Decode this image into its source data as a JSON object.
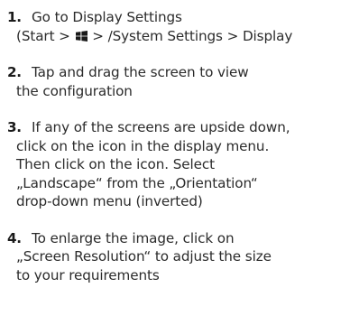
{
  "steps": [
    {
      "number": "1.",
      "lines": [
        "Go to Display Settings"
      ],
      "path": {
        "open": "(Start > ",
        "icon": "windows-logo-icon",
        "rest": " > /System Settings > Display"
      }
    },
    {
      "number": "2.",
      "lines": [
        "Tap and drag the screen to view",
        "the configuration"
      ]
    },
    {
      "number": "3.",
      "lines": [
        "If any of the screens are upside down,",
        "click on the icon in the display menu.",
        "Then click on the icon. Select",
        "„Landscape“ from the „Orientation“",
        "drop-down menu (inverted)"
      ]
    },
    {
      "number": "4.",
      "lines": [
        "To enlarge the image, click on",
        "„Screen Resolution“ to adjust the size",
        "to your requirements"
      ]
    }
  ]
}
